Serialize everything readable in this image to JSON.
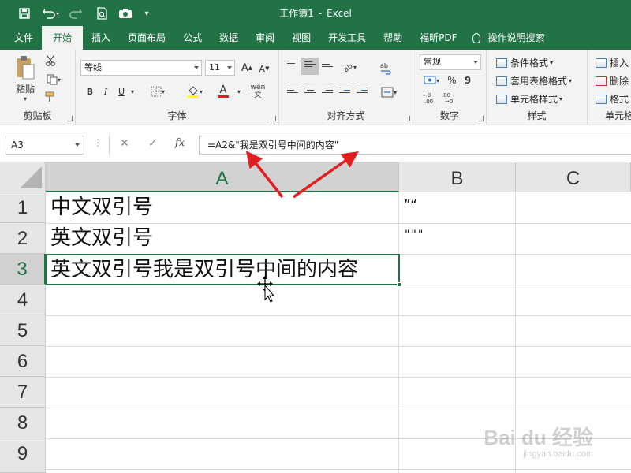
{
  "app": {
    "file_name": "工作簿1",
    "separator": "-",
    "app_name": "Excel"
  },
  "tabs": [
    "文件",
    "开始",
    "插入",
    "页面布局",
    "公式",
    "数据",
    "审阅",
    "视图",
    "开发工具",
    "帮助",
    "福昕PDF"
  ],
  "tell_me": "操作说明搜索",
  "ribbon": {
    "clipboard": {
      "paste": "粘贴",
      "label": "剪贴板"
    },
    "font": {
      "name": "等线",
      "size": "11",
      "bold": "B",
      "italic": "I",
      "underline": "U",
      "label": "字体",
      "grow": "A",
      "shrink": "A",
      "color_a": "A",
      "phonetic": "wén",
      "phonetic2": "文"
    },
    "alignment": {
      "label": "对齐方式"
    },
    "number": {
      "format": "常规",
      "percent": "%",
      "comma": "9",
      "label": "数字"
    },
    "styles": {
      "conditional": "条件格式",
      "table": "套用表格格式",
      "cell": "单元格样式",
      "label": "样式"
    },
    "cells": {
      "insert": "插入",
      "delete": "删除",
      "format": "格式",
      "label": "单元格"
    }
  },
  "formula_bar": {
    "name_box": "A3",
    "cancel": "✕",
    "enter": "✓",
    "fx": "fx",
    "formula": "=A2&\"我是双引号中间的内容\""
  },
  "columns": [
    "A",
    "B",
    "C"
  ],
  "rows": [
    "1",
    "2",
    "3",
    "4",
    "5",
    "6",
    "7",
    "8",
    "9"
  ],
  "cells": {
    "A1": "中文双引号",
    "A2": "英文双引号",
    "A3": "英文双引号我是双引号中间的内容",
    "B1": "”“",
    "B2": "\"\"\""
  },
  "watermark": {
    "line1": "Bai du 经验",
    "line2": "jingyan.baidu.com"
  },
  "colors": {
    "accent": "#217346",
    "arrow": "#e02020"
  }
}
